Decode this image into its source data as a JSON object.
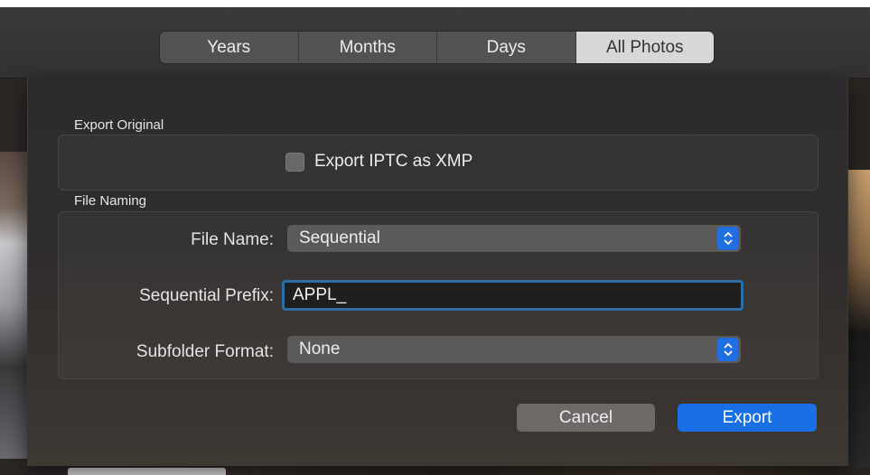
{
  "toolbar": {
    "tabs": [
      {
        "label": "Years",
        "active": false
      },
      {
        "label": "Months",
        "active": false
      },
      {
        "label": "Days",
        "active": false
      },
      {
        "label": "All Photos",
        "active": true
      }
    ]
  },
  "dialog": {
    "export_original": {
      "title": "Export Original",
      "iptc_checkbox_label": "Export IPTC as XMP",
      "iptc_checked": false
    },
    "file_naming": {
      "title": "File Naming",
      "file_name_label": "File Name:",
      "file_name_value": "Sequential",
      "prefix_label": "Sequential Prefix:",
      "prefix_value": "APPL_",
      "subfolder_label": "Subfolder Format:",
      "subfolder_value": "None"
    },
    "buttons": {
      "cancel": "Cancel",
      "export": "Export"
    }
  },
  "colors": {
    "accent": "#1a6fe5",
    "focus_ring": "#2f6ea3"
  },
  "icons": {
    "popup_stepper": "chevron-up-down-icon"
  }
}
